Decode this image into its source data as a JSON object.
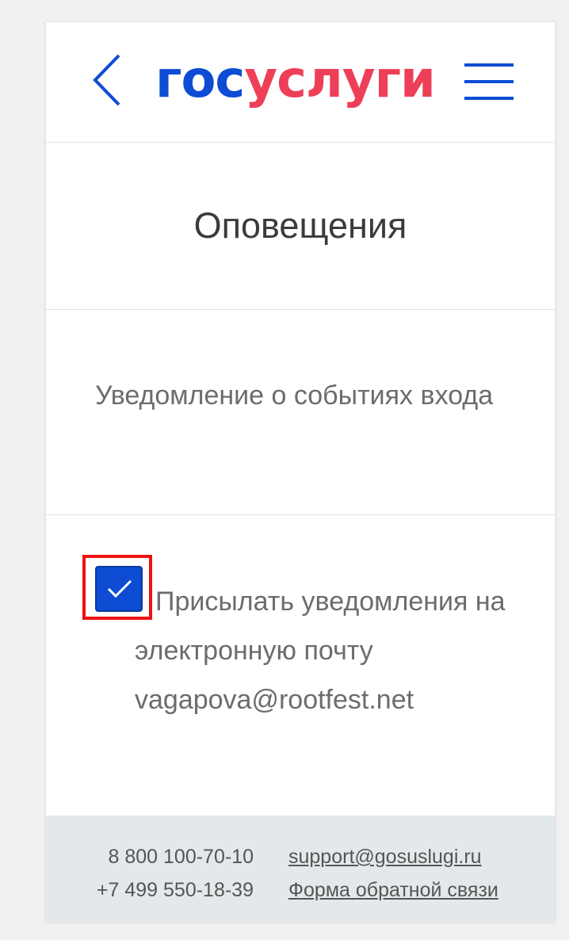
{
  "header": {
    "back_icon": "chevron-left-icon",
    "logo": {
      "part1": "гос",
      "part2": "услуги"
    },
    "menu_icon": "hamburger-menu-icon"
  },
  "page": {
    "title": "Оповещения"
  },
  "section": {
    "title": "Уведомление о событиях входа"
  },
  "option": {
    "checked": true,
    "label": "Присылать уведомления на электронную почту vagapova@rootfest.net"
  },
  "footer": {
    "phone1": "8 800 100-70-10",
    "phone2": "+7 499 550-18-39",
    "email_link": "support@gosuslugi.ru",
    "feedback_link": "Форма обратной связи"
  },
  "colors": {
    "brand_blue": "#0d4cd3",
    "brand_red": "#ee3f58",
    "highlight_red": "#ee1111",
    "footer_bg": "#e3e9ea"
  }
}
